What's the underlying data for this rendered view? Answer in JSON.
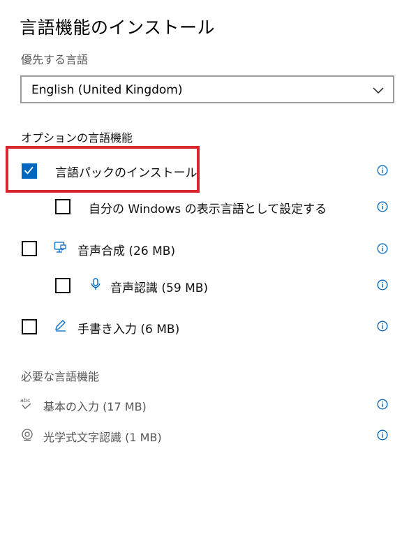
{
  "page": {
    "title": "言語機能のインストール",
    "preferred_language_label": "優先する言語",
    "preferred_language_value": "English (United Kingdom)"
  },
  "optional": {
    "heading": "オプションの言語機能",
    "items": [
      {
        "label": "言語パックのインストール",
        "checked": true,
        "icon": ""
      },
      {
        "label": "自分の Windows の表示言語として設定する",
        "checked": false,
        "icon": ""
      },
      {
        "label": "音声合成 (26 MB)",
        "checked": false,
        "icon": "speech-synthesis-icon"
      },
      {
        "label": "音声認識 (59 MB)",
        "checked": false,
        "icon": "microphone-icon"
      },
      {
        "label": "手書き入力 (6 MB)",
        "checked": false,
        "icon": "pen-icon"
      }
    ]
  },
  "required": {
    "heading": "必要な言語機能",
    "items": [
      {
        "label": "基本の入力 (17 MB)",
        "icon": "abc-check-icon"
      },
      {
        "label": "光学式文字認識 (1 MB)",
        "icon": "camera-eye-icon"
      }
    ]
  },
  "colors": {
    "accent": "#0067c0",
    "highlight": "#d7262d"
  }
}
